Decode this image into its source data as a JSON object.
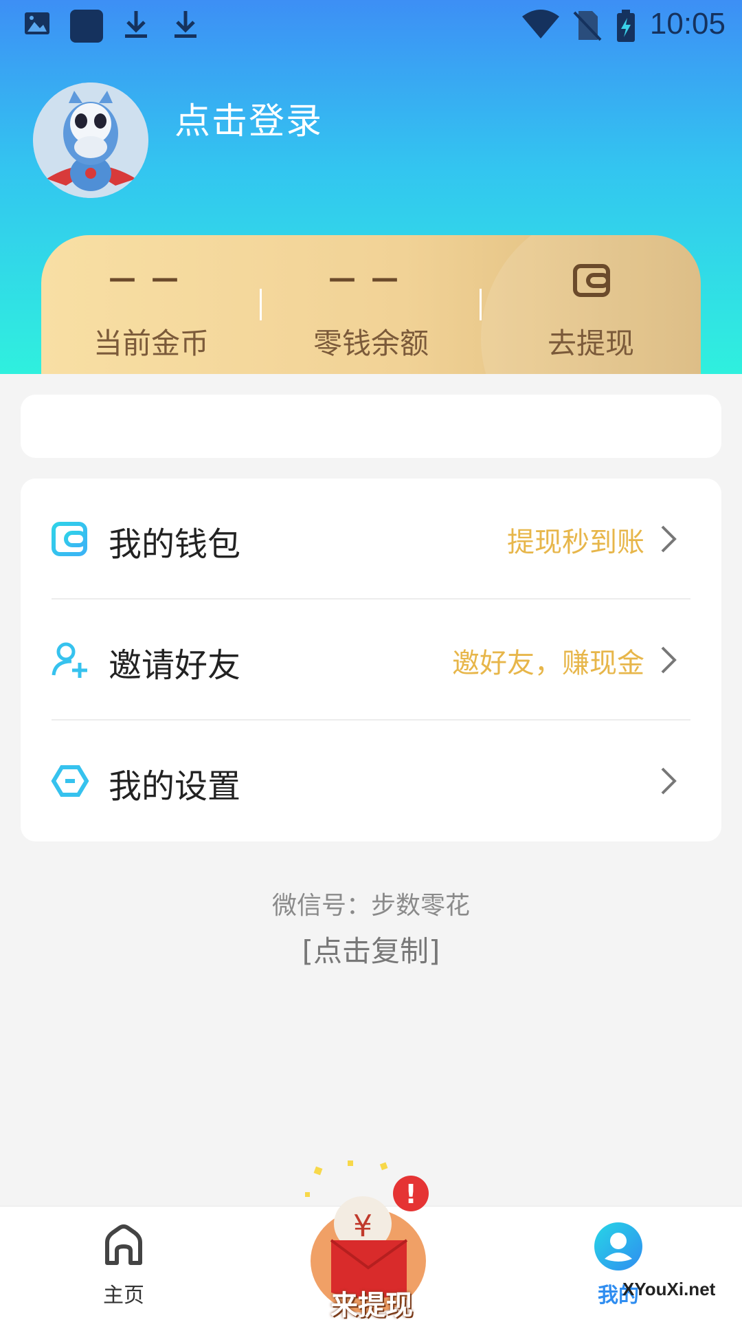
{
  "status_bar": {
    "time": "10:05"
  },
  "profile": {
    "login_text": "点击登录"
  },
  "stats": [
    {
      "value": "——",
      "label": "当前金币"
    },
    {
      "value": "——",
      "label": "零钱余额"
    },
    {
      "label": "去提现"
    }
  ],
  "menu": [
    {
      "label": "我的钱包",
      "hint": "提现秒到账",
      "icon": "wallet-icon"
    },
    {
      "label": "邀请好友",
      "hint": "邀好友，赚现金",
      "icon": "add-user-icon"
    },
    {
      "label": "我的设置",
      "hint": "",
      "icon": "settings-hexagon-icon"
    }
  ],
  "wechat": {
    "line1": "微信号：步数零花",
    "copy": "[点击复制]"
  },
  "bottom_nav": {
    "home": "主页",
    "promo": "来提现",
    "mine": "我的"
  },
  "watermark": "XYouXi.net",
  "colors": {
    "accent_gold": "#e7b64a",
    "nav_active": "#2f8df0",
    "header_top": "#3d8ff5",
    "header_bottom": "#2ff0de"
  }
}
